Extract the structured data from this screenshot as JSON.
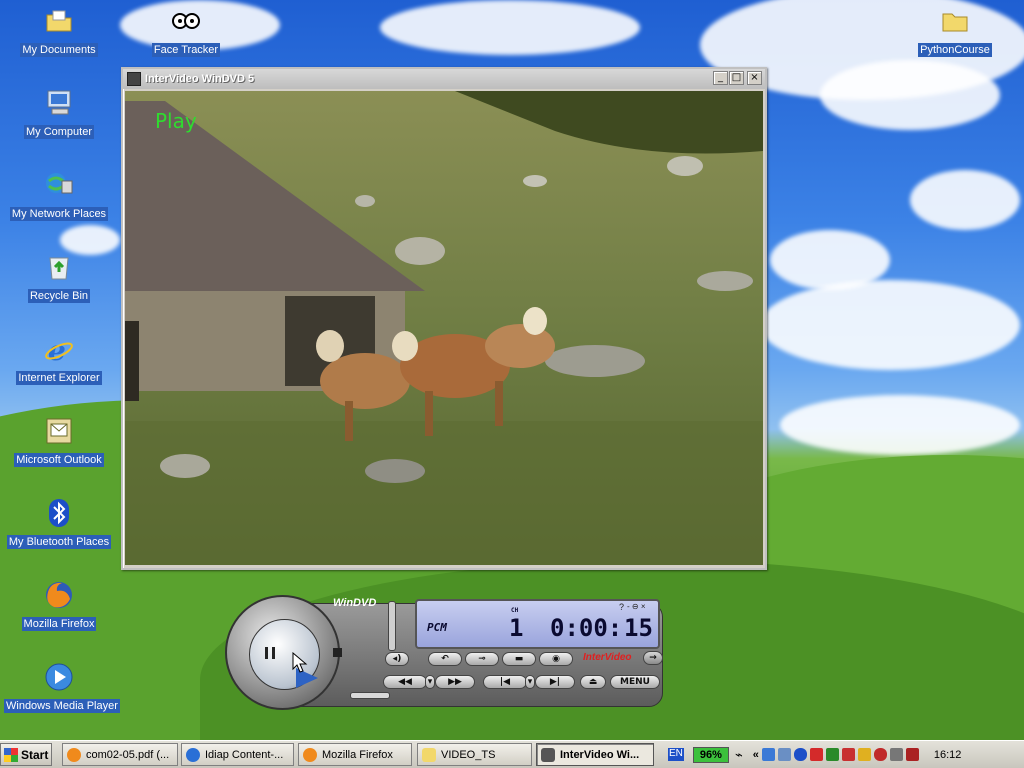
{
  "desktop": {
    "icons": [
      {
        "label": "My Documents"
      },
      {
        "label": "Face Tracker"
      },
      {
        "label": "PythonCourse"
      },
      {
        "label": "My Computer"
      },
      {
        "label": "My Network Places"
      },
      {
        "label": "Recycle Bin"
      },
      {
        "label": "Internet Explorer"
      },
      {
        "label": "Microsoft Outlook"
      },
      {
        "label": "My Bluetooth Places"
      },
      {
        "label": "Mozilla Firefox"
      },
      {
        "label": "Windows Media Player"
      }
    ]
  },
  "dvd_window": {
    "title": "InterVideo WinDVD 5",
    "osd": "Play",
    "buttons": {
      "minimize": "_",
      "maximize": "□",
      "close": "×"
    }
  },
  "dvd_panel": {
    "logo": "WinDVD",
    "audio": "PCM",
    "chapter_label": "CH",
    "chapter": "1",
    "time_hm": "0:00:",
    "time_s": "15",
    "brand": "InterVideo",
    "menu_label": "MENU",
    "help": "?",
    "mini_controls": "- ⊖ ×"
  },
  "taskbar": {
    "start_label": "Start",
    "tasks": [
      {
        "label": "com02-05.pdf (..."
      },
      {
        "label": "Idiap Content-..."
      },
      {
        "label": "Mozilla Firefox"
      },
      {
        "label": "VIDEO_TS"
      },
      {
        "label": "InterVideo Wi..."
      }
    ],
    "tray": {
      "language": "EN",
      "battery": "96%",
      "expand": "«",
      "clock": "16:12"
    }
  }
}
